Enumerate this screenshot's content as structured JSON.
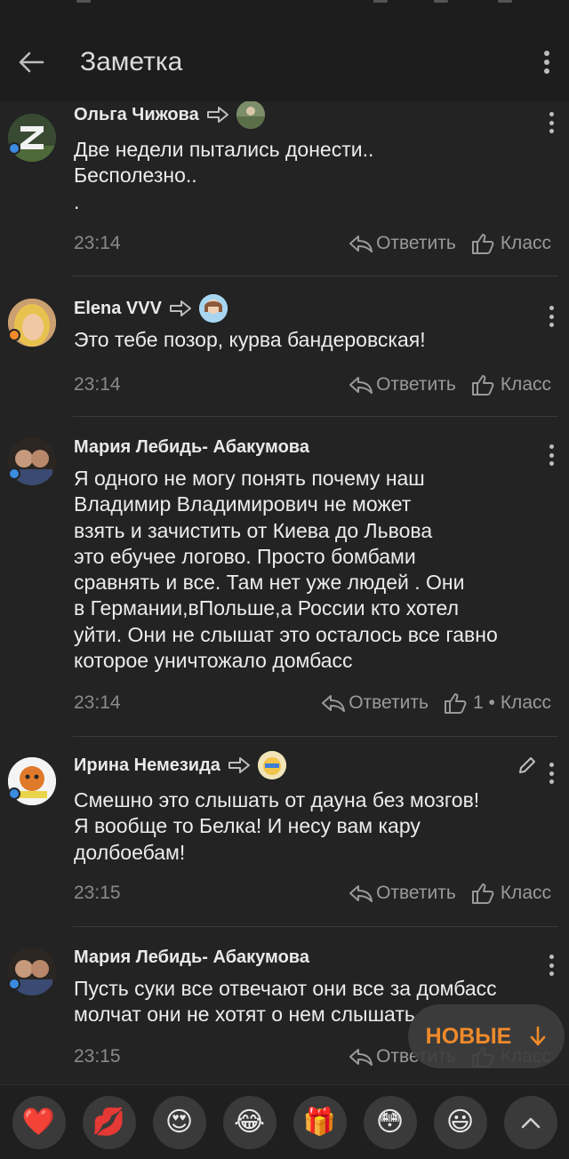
{
  "app_bar": {
    "title": "Заметка"
  },
  "labels": {
    "reply": "Ответить",
    "like": "Класс"
  },
  "comments": [
    {
      "author": "Ольга Чижова",
      "lines": [
        "Две недели пытались донести..",
        "Бесполезно..",
        "."
      ],
      "time": "23:14",
      "likes": ""
    },
    {
      "author": "Elena VVV",
      "lines": [
        "Это тебе позор, курва бандеровская!"
      ],
      "time": "23:14",
      "likes": ""
    },
    {
      "author": "Мария Лебидь- Абакумова",
      "lines": [
        "Я одного не могу понять почему наш",
        "Владимир Владимирович не может",
        "взять и зачистить от Киева до Львова",
        "это ебучее логово.  Просто бомбами",
        "сравнять и все. Там нет уже людей  . Они",
        "в Германии,вПольше,а России кто хотел",
        "уйти. Они не слышат это осталось все гавно",
        "которое уничтожало домбасс"
      ],
      "time": "23:14",
      "likes": "1 •"
    },
    {
      "author": "Ирина Немезида",
      "lines": [
        "Смешно это слышать от дауна без мозгов!",
        "Я вообще то Белка! И несу вам кару",
        "долбоебам!"
      ],
      "time": "23:15",
      "likes": ""
    },
    {
      "author": "Мария Лебидь- Абакумова",
      "lines": [
        "Пусть суки все отвечают они все за домбасс",
        "молчат они не хотят о нем слышать"
      ],
      "time": "23:15",
      "likes": ""
    }
  ],
  "new_button": {
    "label": "НОВЫЕ",
    "accent": "#f08a2a"
  },
  "reactions": [
    "❤️",
    "💋",
    "😍",
    "😂",
    "🎁",
    "😳",
    "😃"
  ]
}
